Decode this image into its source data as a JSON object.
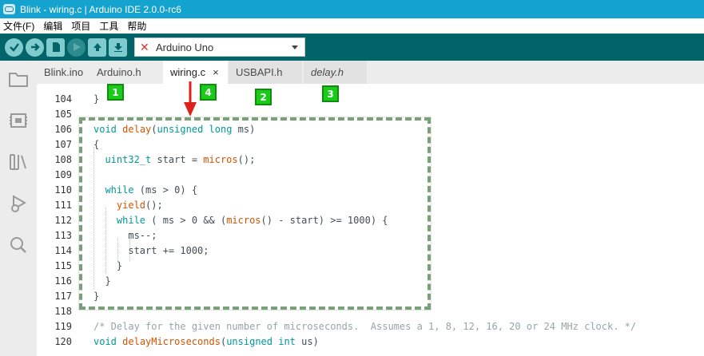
{
  "window": {
    "title": "Blink - wiring.c | Arduino IDE 2.0.0-rc6"
  },
  "menu": [
    "文件(F)",
    "编辑",
    "项目",
    "工具",
    "帮助"
  ],
  "toolbar": {
    "buttons": [
      "verify",
      "upload",
      "new",
      "debug",
      "open",
      "save"
    ],
    "board": "Arduino Uno"
  },
  "tabs": [
    {
      "label": "Blink.ino"
    },
    {
      "label": "Arduino.h"
    },
    {
      "label": "wiring.c",
      "close": "×"
    },
    {
      "label": "USBAPI.h"
    },
    {
      "label": "delay.h"
    }
  ],
  "badges": [
    "1",
    "4",
    "2",
    "3"
  ],
  "editor": {
    "lines": [
      {
        "num": "",
        "code": ""
      },
      {
        "num": "104",
        "code": "}"
      },
      {
        "num": "105",
        "code": ""
      },
      {
        "num": "106",
        "code": "void delay(unsigned long ms)"
      },
      {
        "num": "107",
        "code": "{"
      },
      {
        "num": "108",
        "code": "  uint32_t start = micros();"
      },
      {
        "num": "109",
        "code": ""
      },
      {
        "num": "110",
        "code": "  while (ms > 0) {"
      },
      {
        "num": "111",
        "code": "    yield();"
      },
      {
        "num": "112",
        "code": "    while ( ms > 0 && (micros() - start) >= 1000) {"
      },
      {
        "num": "113",
        "code": "      ms--;"
      },
      {
        "num": "114",
        "code": "      start += 1000;"
      },
      {
        "num": "115",
        "code": "    }"
      },
      {
        "num": "116",
        "code": "  }"
      },
      {
        "num": "117",
        "code": "}"
      },
      {
        "num": "118",
        "code": ""
      },
      {
        "num": "119",
        "code": "/* Delay for the given number of microseconds.  Assumes a 1, 8, 12, 16, 20 or 24 MHz clock. */"
      },
      {
        "num": "120",
        "code": "void delayMicroseconds(unsigned int us)"
      },
      {
        "num": "",
        "code": ""
      }
    ]
  },
  "colors": {
    "titlebar": "#14a2ce",
    "toolbar": "#006468",
    "keyword": "#00979c",
    "function": "#d35400",
    "comment": "#95a5a6",
    "badge": "#1acb1a",
    "arrow": "#e0201c"
  }
}
